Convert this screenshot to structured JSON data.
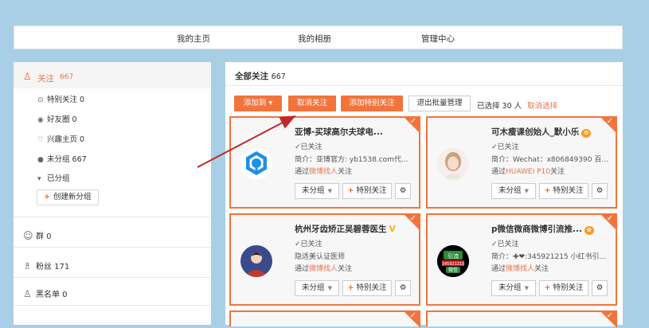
{
  "topnav": {
    "home": "我的主页",
    "album": "我的相册",
    "manage": "管理中心"
  },
  "sidebar": {
    "follow_label": "关注",
    "follow_count": "667",
    "sub_items": [
      {
        "icon": "special-icon",
        "label": "特别关注 0"
      },
      {
        "icon": "friends-icon",
        "label": "好友圈 0"
      },
      {
        "icon": "interest-icon",
        "label": "兴趣主页 0"
      },
      {
        "icon": "dot-icon",
        "label": "未分组 667"
      },
      {
        "icon": "caret-down-icon",
        "label": "已分组"
      }
    ],
    "create_group": "创建新分组",
    "groups_label": "群 0",
    "fans_label": "粉丝 171",
    "blacklist_label": "黑名单 0"
  },
  "main": {
    "title": "全部关注",
    "count": "667",
    "btn_add": "添加到",
    "btn_unfollow": "取消关注",
    "btn_add_special": "添加特别关注",
    "btn_exit_batch": "退出批量管理",
    "selected_text": "已选择 30 人",
    "cancel_selection": "取消选择"
  },
  "cards": [
    {
      "name": "亚博-买球高尔夫球电...",
      "followed": "已关注",
      "intro": "简介：亚博官方: yb1538.com代...",
      "via_prefix": "通过",
      "via_link": "微博找人",
      "via_suffix": "关注",
      "group": "未分组",
      "special": "特别关注"
    },
    {
      "name": "可木瘦课创始人_默小乐",
      "followed": "已关注",
      "intro": "简介：Wechat：x806849390 百...",
      "via_prefix": "通过",
      "via_link": "HUAWEI P10",
      "via_suffix": "关注",
      "group": "未分组",
      "special": "特别关注"
    },
    {
      "name": "杭州牙齿矫正吴碧蓉医生",
      "followed": "已关注",
      "intro": "隐适美认证医师",
      "via_prefix": "通过",
      "via_link": "微博找人",
      "via_suffix": "关注",
      "group": "未分组",
      "special": "特别关注"
    },
    {
      "name": "p微信微商微博引流推...",
      "followed": "已关注",
      "intro": "简介：✚❤:345921215 小红书引...",
      "via_prefix": "通过",
      "via_link": "微博找人",
      "via_suffix": "关注",
      "group": "未分组",
      "special": "特别关注"
    }
  ],
  "avatar4_text": {
    "top": "引流",
    "mid": "345921215",
    "bot": "微信"
  },
  "colors": {
    "accent": "#f2743c",
    "link": "#eb7350",
    "bg": "#a9cfe6",
    "arrow": "#c0282b"
  }
}
